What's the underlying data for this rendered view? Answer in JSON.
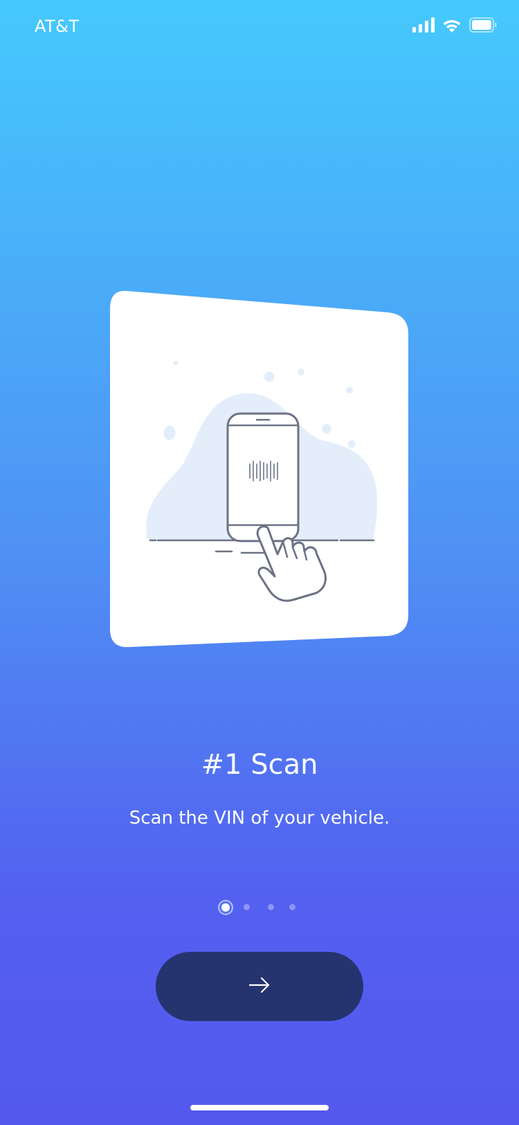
{
  "status_bar": {
    "carrier": "AT&T",
    "icons": [
      "cellular-signal-icon",
      "wifi-icon",
      "battery-icon"
    ]
  },
  "onboarding": {
    "illustration": "phone-barcode-scan-illustration",
    "title": "#1 Scan",
    "subtitle": "Scan the VIN of your vehicle.",
    "page_indicator": {
      "total": 4,
      "current": 1
    },
    "next_button": {
      "icon": "arrow-right-icon"
    }
  },
  "colors": {
    "gradient_top": "#45C9FD",
    "gradient_bottom": "#5458EE",
    "button": "#25346F",
    "illustration_blob": "#E4EEFB",
    "illustration_line": "#6B7285"
  }
}
